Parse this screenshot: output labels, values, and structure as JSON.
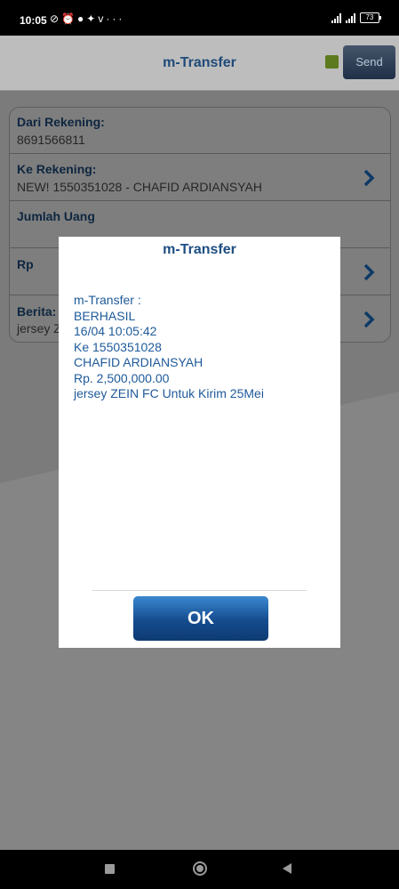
{
  "status_bar": {
    "time": "10:05",
    "notification_icons": [
      "silent-icon",
      "alarm-icon",
      "whatsapp-icon",
      "twitter-icon",
      "vimeo-icon",
      "more-icon"
    ],
    "battery": "73"
  },
  "header": {
    "title": "m-Transfer",
    "send_label": "Send"
  },
  "form": {
    "dari_label": "Dari Rekening:",
    "dari_value": "8691566811",
    "ke_label": "Ke Rekening:",
    "ke_value": "NEW! 1550351028 - CHAFID ARDIANSYAH",
    "jumlah_label": "Jumlah Uang",
    "rp_label": "Rp",
    "berita_label": "Berita:",
    "berita_value": "jersey Z"
  },
  "dialog": {
    "title": "m-Transfer",
    "lines": [
      "m-Transfer :",
      "BERHASIL",
      "16/04 10:05:42",
      "Ke 1550351028",
      "CHAFID ARDIANSYAH",
      "Rp. 2,500,000.00",
      "jersey ZEIN FC Untuk Kirim 25Mei"
    ],
    "ok_label": "OK"
  },
  "colors": {
    "accent": "#1e4e82",
    "ok_button": "#154c8e",
    "led": "#5d7a1e"
  }
}
